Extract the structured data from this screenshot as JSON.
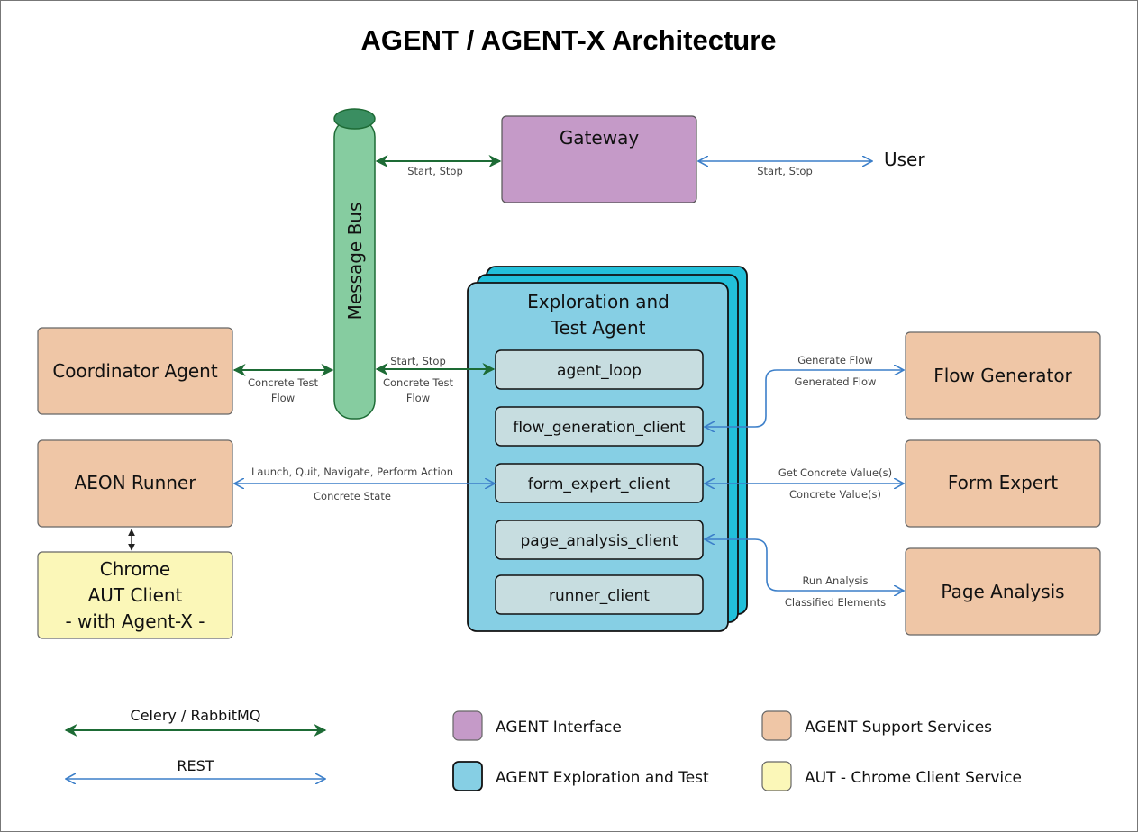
{
  "title": "AGENT / AGENT-X Architecture",
  "colors": {
    "interface": "#c59ac8",
    "support": "#efc6a6",
    "exploration": "#86cfe4",
    "exploration_back": "#22c0da",
    "client_box": "#c7dde0",
    "aut": "#fbf7b8",
    "bus": "#86cca0",
    "bus_top": "#3a8e61",
    "celery": "#1d6b35",
    "rest": "#3c7fc9"
  },
  "nodes": {
    "message_bus": "Message Bus",
    "gateway": "Gateway",
    "user": "User",
    "coordinator": "Coordinator Agent",
    "aeon_runner": "AEON Runner",
    "chrome_client": [
      "Chrome",
      "AUT Client",
      "- with Agent-X -"
    ],
    "exploration_agent": [
      "Exploration and",
      "Test Agent"
    ],
    "clients": [
      "agent_loop",
      "flow_generation_client",
      "form_expert_client",
      "page_analysis_client",
      "runner_client"
    ],
    "flow_generator": "Flow Generator",
    "form_expert": "Form Expert",
    "page_analysis": "Page Analysis"
  },
  "edges": {
    "bus_gateway": "Start, Stop",
    "gateway_user": "Start, Stop",
    "coordinator_bus": [
      "Concrete Test",
      "Flow"
    ],
    "bus_agent_top": "Start, Stop",
    "bus_agent_bottom": [
      "Concrete Test",
      "Flow"
    ],
    "runner_top": "Launch, Quit, Navigate, Perform Action",
    "runner_bottom": "Concrete State",
    "flow_top": "Generate Flow",
    "flow_bottom": "Generated Flow",
    "form_top": "Get Concrete Value(s)",
    "form_bottom": "Concrete Value(s)",
    "page_top": "Run Analysis",
    "page_bottom": "Classified Elements"
  },
  "legend": {
    "celery": "Celery / RabbitMQ",
    "rest": "REST",
    "items": [
      {
        "label": "AGENT Interface",
        "key": "interface"
      },
      {
        "label": "AGENT Support Services",
        "key": "support"
      },
      {
        "label": "AGENT Exploration and Test",
        "key": "exploration"
      },
      {
        "label": "AUT - Chrome Client Service",
        "key": "aut"
      }
    ]
  }
}
